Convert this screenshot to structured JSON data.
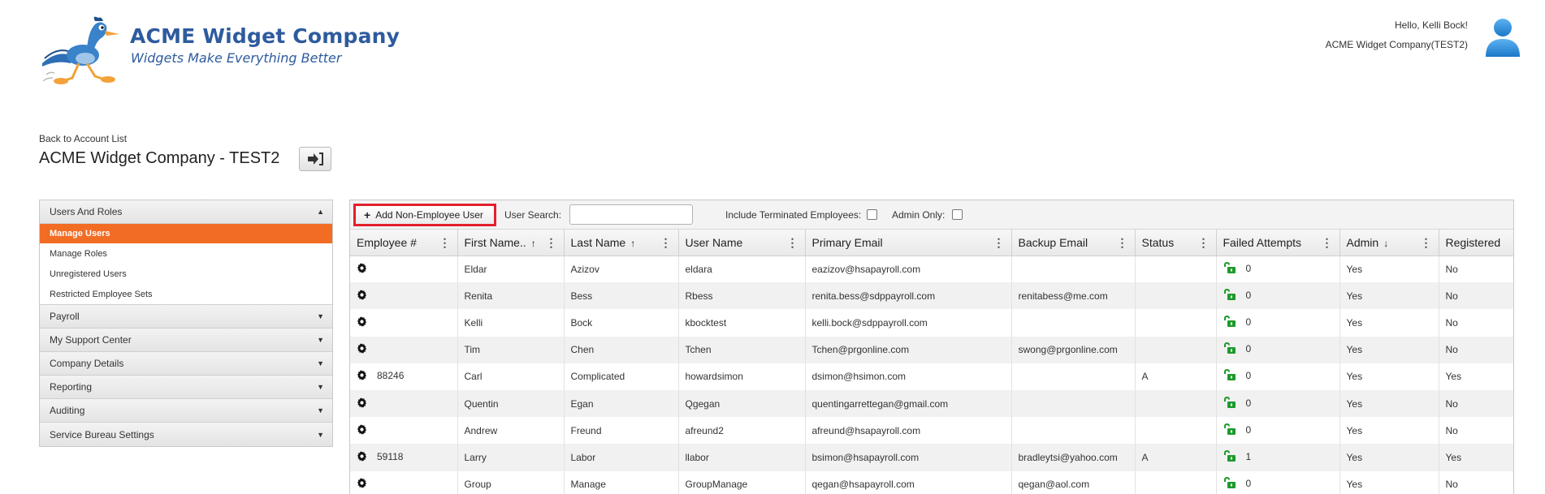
{
  "header": {
    "brand_name": "ACME Widget Company",
    "brand_tagline": "Widgets Make Everything Better",
    "greeting": "Hello, Kelli Bock!",
    "company_context": "ACME Widget Company(TEST2)"
  },
  "page": {
    "back_link": "Back to Account List",
    "title": "ACME Widget Company - TEST2"
  },
  "sidebar": {
    "sections": [
      {
        "label": "Users And Roles",
        "expanded": true,
        "items": [
          {
            "label": "Manage Users",
            "active": true
          },
          {
            "label": "Manage Roles"
          },
          {
            "label": "Unregistered Users"
          },
          {
            "label": "Restricted Employee Sets"
          }
        ]
      },
      {
        "label": "Payroll"
      },
      {
        "label": "My Support Center"
      },
      {
        "label": "Company Details"
      },
      {
        "label": "Reporting"
      },
      {
        "label": "Auditing"
      },
      {
        "label": "Service Bureau Settings"
      }
    ]
  },
  "toolbar": {
    "add_button": "Add Non-Employee User",
    "search_label": "User Search:",
    "search_value": "",
    "include_terminated_label": "Include Terminated Employees:",
    "admin_only_label": "Admin Only:"
  },
  "grid": {
    "columns": [
      {
        "label": "Employee #",
        "sort": ""
      },
      {
        "label": "First Name..",
        "sort": "↑"
      },
      {
        "label": "Last Name",
        "sort": "↑"
      },
      {
        "label": "User Name",
        "sort": ""
      },
      {
        "label": "Primary Email",
        "sort": ""
      },
      {
        "label": "Backup Email",
        "sort": ""
      },
      {
        "label": "Status",
        "sort": ""
      },
      {
        "label": "Failed Attempts",
        "sort": ""
      },
      {
        "label": "Admin",
        "sort": "↓"
      },
      {
        "label": "Registered",
        "sort": ""
      }
    ],
    "rows": [
      {
        "emp": "",
        "first": "Eldar",
        "last": "Azizov",
        "user": "eldara",
        "email": "eazizov@hsapayroll.com",
        "backup": "",
        "status": "",
        "failed": "0",
        "admin": "Yes",
        "registered": "No"
      },
      {
        "emp": "",
        "first": "Renita",
        "last": "Bess",
        "user": "Rbess",
        "email": "renita.bess@sdppayroll.com",
        "backup": "renitabess@me.com",
        "status": "",
        "failed": "0",
        "admin": "Yes",
        "registered": "No"
      },
      {
        "emp": "",
        "first": "Kelli",
        "last": "Bock",
        "user": "kbocktest",
        "email": "kelli.bock@sdppayroll.com",
        "backup": "",
        "status": "",
        "failed": "0",
        "admin": "Yes",
        "registered": "No"
      },
      {
        "emp": "",
        "first": "Tim",
        "last": "Chen",
        "user": "Tchen",
        "email": "Tchen@prgonline.com",
        "backup": "swong@prgonline.com",
        "status": "",
        "failed": "0",
        "admin": "Yes",
        "registered": "No"
      },
      {
        "emp": "88246",
        "first": "Carl",
        "last": "Complicated",
        "user": "howardsimon",
        "email": "dsimon@hsimon.com",
        "backup": "",
        "status": "A",
        "failed": "0",
        "admin": "Yes",
        "registered": "Yes"
      },
      {
        "emp": "",
        "first": "Quentin",
        "last": "Egan",
        "user": "Qgegan",
        "email": "quentingarrettegan@gmail.com",
        "backup": "",
        "status": "",
        "failed": "0",
        "admin": "Yes",
        "registered": "No"
      },
      {
        "emp": "",
        "first": "Andrew",
        "last": "Freund",
        "user": "afreund2",
        "email": "afreund@hsapayroll.com",
        "backup": "",
        "status": "",
        "failed": "0",
        "admin": "Yes",
        "registered": "No"
      },
      {
        "emp": "59118",
        "first": "Larry",
        "last": "Labor",
        "user": "llabor",
        "email": "bsimon@hsapayroll.com",
        "backup": "bradleytsi@yahoo.com",
        "status": "A",
        "failed": "1",
        "admin": "Yes",
        "registered": "Yes"
      },
      {
        "emp": "",
        "first": "Group",
        "last": "Manage",
        "user": "GroupManage",
        "email": "qegan@hsapayroll.com",
        "backup": "qegan@aol.com",
        "status": "",
        "failed": "0",
        "admin": "Yes",
        "registered": "No"
      }
    ]
  },
  "colors": {
    "brand_blue": "#2e5b9e",
    "active_orange": "#f26c24",
    "highlight_red": "#e3202a",
    "lock_green": "#1e9a2c"
  },
  "icons": {
    "logo": "roadrunner-logo-icon",
    "user": "user-avatar-icon",
    "switch": "arrow-into-door-icon",
    "row_action": "gear-icon",
    "unlock": "unlock-icon"
  }
}
